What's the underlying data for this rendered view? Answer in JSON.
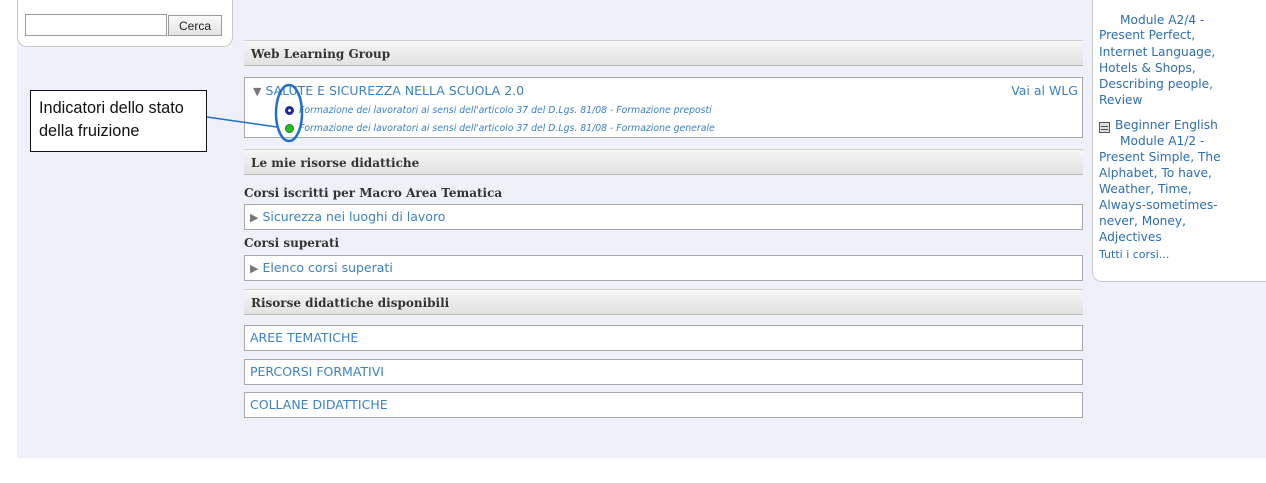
{
  "search": {
    "button_label": "Cerca",
    "value": ""
  },
  "main": {
    "web_learning_group": {
      "header": "Web Learning Group",
      "group_title": "SALUTE E SICUREZZA NELLA SCUOLA 2.0",
      "group_link": "Vai al WLG",
      "courses": [
        {
          "title": "Formazione dei lavoratori ai sensi dell'articolo 37 del D.Lgs. 81/08 - Formazione preposti",
          "status": "in-progress",
          "status_color": "#1a2a9c"
        },
        {
          "title": "Formazione dei lavoratori ai sensi dell'articolo 37 del  D.Lgs. 81/08 - Formazione generale",
          "status": "completed",
          "status_color": "#22c022"
        }
      ]
    },
    "my_resources": {
      "header": "Le mie risorse didattiche",
      "enrolled_heading": "Corsi iscritti per Macro Area Tematica",
      "enrolled_item": "Sicurezza nei luoghi di lavoro",
      "passed_heading": "Corsi superati",
      "passed_item": "Elenco corsi superati"
    },
    "available_resources": {
      "header": "Risorse didattiche disponibili",
      "items": [
        "AREE TEMATICHE",
        "PERCORSI FORMATIVI",
        "COLLANE DIDATTICHE"
      ]
    }
  },
  "right_panel": {
    "lines": [
      "Module A2/4 -",
      "Present Perfect,",
      "Internet Language,",
      "Hotels & Shops,",
      "Describing people,",
      "Review",
      "Beginner English",
      "Module A1/2 -",
      "Present Simple, The",
      "Alphabet, To have,",
      "Weather, Time,",
      "Always-sometimes-",
      "never, Money,",
      "Adjectives"
    ],
    "all_courses_link": "Tutti i corsi..."
  },
  "annotation": {
    "line1": "Indicatori dello stato",
    "line2": "della fruizione"
  },
  "colors": {
    "link": "#3c82c4",
    "annotation_ring": "#1f6fd0"
  }
}
